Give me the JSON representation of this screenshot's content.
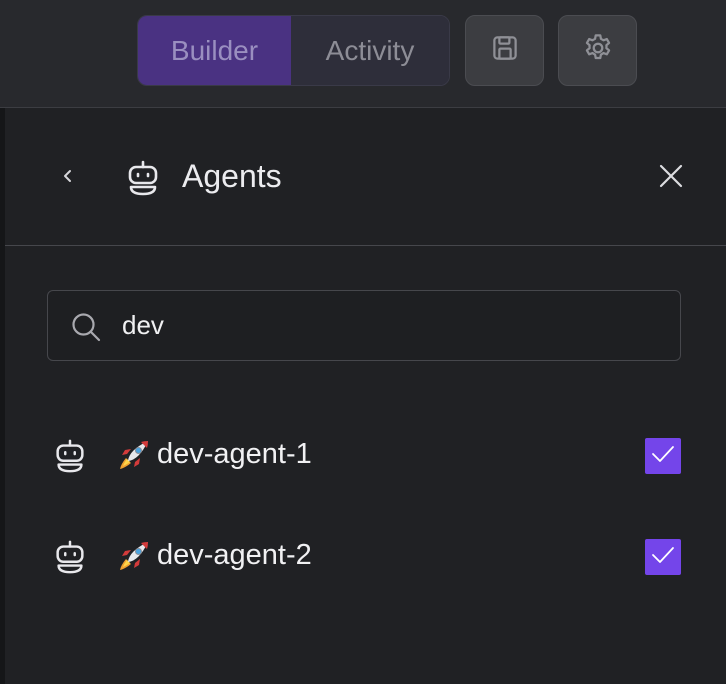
{
  "topbar": {
    "tabs": [
      {
        "label": "Builder",
        "active": true
      },
      {
        "label": "Activity",
        "active": false
      }
    ],
    "save_icon": "save-icon",
    "settings_icon": "gear-icon"
  },
  "panel": {
    "title": "Agents",
    "back_icon": "chevron-left-icon",
    "title_icon": "robot-icon",
    "close_icon": "close-icon"
  },
  "search": {
    "value": "dev",
    "placeholder": "",
    "icon": "search-icon"
  },
  "agents": [
    {
      "emoji": "🚀",
      "name": "dev-agent-1",
      "checked": true,
      "icon": "robot-icon"
    },
    {
      "emoji": "🚀",
      "name": "dev-agent-2",
      "checked": true,
      "icon": "robot-icon"
    }
  ],
  "colors": {
    "accent": "#7445ea",
    "active_tab_bg": "#4a3282",
    "background": "#202124",
    "topbar_bg": "#28292d"
  }
}
